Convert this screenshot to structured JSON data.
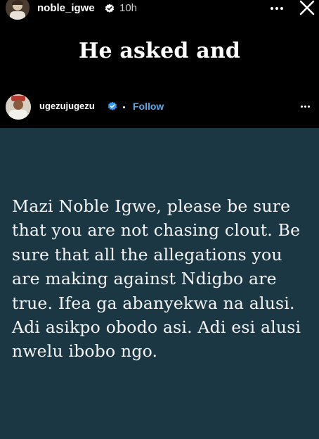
{
  "story": {
    "username": "noble_igwe",
    "time_ago": "10h",
    "caption": "He asked and"
  },
  "post": {
    "username": "ugezujugezu",
    "follow_label": "Follow",
    "text": "Mazi Noble Igwe, please be sure that you are not chasing clout. Be sure that all the allegations you are making against Ndigbo are true. Ifea ga abanyekwa na alusi. Adi asikpo obodo asi. Adi esi alusi nwelu ibobo ngo."
  },
  "colors": {
    "background": "#000000",
    "post_background": "#1c3744",
    "follow_blue": "#5aa9e6",
    "verified_blue": "#3897f0"
  },
  "icons": [
    "avatar",
    "verified-badge-icon",
    "more-options-icon",
    "close-icon"
  ]
}
